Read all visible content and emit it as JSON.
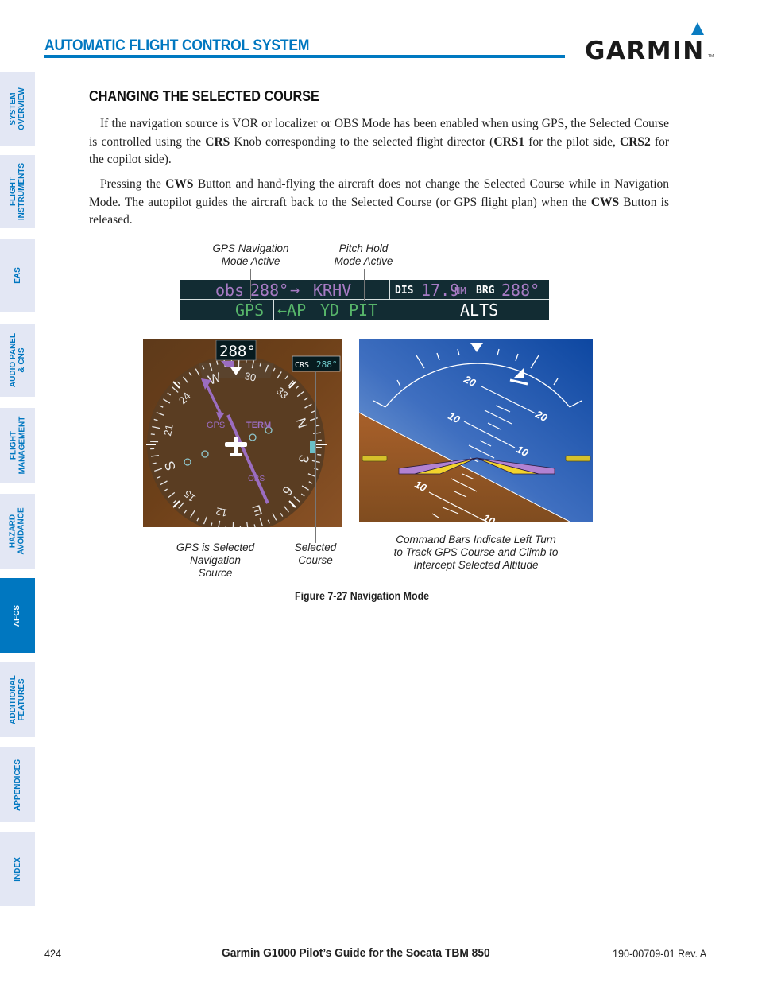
{
  "header": {
    "section_title": "AUTOMATIC FLIGHT CONTROL SYSTEM",
    "logo_text": "GARMIN",
    "logo_tm": "TM",
    "brand_color": "#0077c0"
  },
  "sidebar": {
    "tabs": [
      {
        "label": "SYSTEM\nOVERVIEW",
        "active": false
      },
      {
        "label": "FLIGHT\nINSTRUMENTS",
        "active": false
      },
      {
        "label": "EAS",
        "active": false
      },
      {
        "label": "AUDIO PANEL\n& CNS",
        "active": false
      },
      {
        "label": "FLIGHT\nMANAGEMENT",
        "active": false
      },
      {
        "label": "HAZARD\nAVOIDANCE",
        "active": false
      },
      {
        "label": "AFCS",
        "active": true
      },
      {
        "label": "ADDITIONAL\nFEATURES",
        "active": false
      },
      {
        "label": "APPENDICES",
        "active": false
      },
      {
        "label": "INDEX",
        "active": false
      }
    ]
  },
  "content": {
    "heading": "CHANGING THE SELECTED COURSE",
    "paragraph1": {
      "t1": "If the navigation source is VOR or localizer or OBS Mode has been enabled when using GPS, the Selected Course is controlled using the ",
      "b1": "CRS",
      "t2": " Knob corresponding to the selected flight director (",
      "b2": "CRS1",
      "t3": " for the pilot side, ",
      "b3": "CRS2",
      "t4": " for the copilot side)."
    },
    "paragraph2": {
      "t1": "Pressing the ",
      "b1": "CWS",
      "t2": " Button and hand-flying the aircraft does not change the Selected Course while in Navigation Mode.  The autopilot guides the aircraft back to the Selected Course (or GPS flight plan) when the ",
      "b2": "CWS",
      "t3": " Button is released."
    }
  },
  "figure": {
    "callouts": {
      "gps_nav_mode": "GPS Navigation\nMode Active",
      "pitch_hold": "Pitch Hold\nMode Active",
      "gps_source": "GPS is Selected\nNavigation\nSource",
      "selected_course": "Selected\nCourse",
      "command_bars": "Command Bars Indicate Left Turn\nto Track GPS Course and Climb to\nIntercept Selected Altitude"
    },
    "status_bar": {
      "nav_line": {
        "mode": "obs",
        "course": "288°",
        "arrow": "→",
        "waypoint": "KRHV"
      },
      "dis_label": "DIS",
      "dis_value": "17.9",
      "dis_unit": "NM",
      "brg_label": "BRG",
      "brg_value": "288°",
      "lateral_mode": "GPS",
      "ap_status": "←AP",
      "yd_status": "YD",
      "vertical_mode": "PIT",
      "armed_vertical": "ALTS",
      "colors": {
        "magenta": "#a77bc4",
        "green": "#57b56a",
        "white": "#ffffff",
        "bg": "#122c33"
      }
    },
    "hsi": {
      "heading_readout": "288°",
      "crs_label": "CRS",
      "crs_value": "288°",
      "nav_source": "GPS",
      "flight_phase": "TERM",
      "obs_annunciation": "OBS",
      "compass_labels": [
        "N",
        "3",
        "6",
        "E",
        "12",
        "15",
        "S",
        "21",
        "24",
        "W",
        "30",
        "33"
      ]
    },
    "adi": {
      "pitch_labels": [
        "20",
        "20",
        "10",
        "10",
        "10",
        "10"
      ]
    },
    "caption": "Figure 7-27  Navigation Mode"
  },
  "footer": {
    "page_number": "424",
    "title": "Garmin G1000 Pilot’s Guide for the Socata TBM 850",
    "doc_number": "190-00709-01  Rev. A"
  }
}
